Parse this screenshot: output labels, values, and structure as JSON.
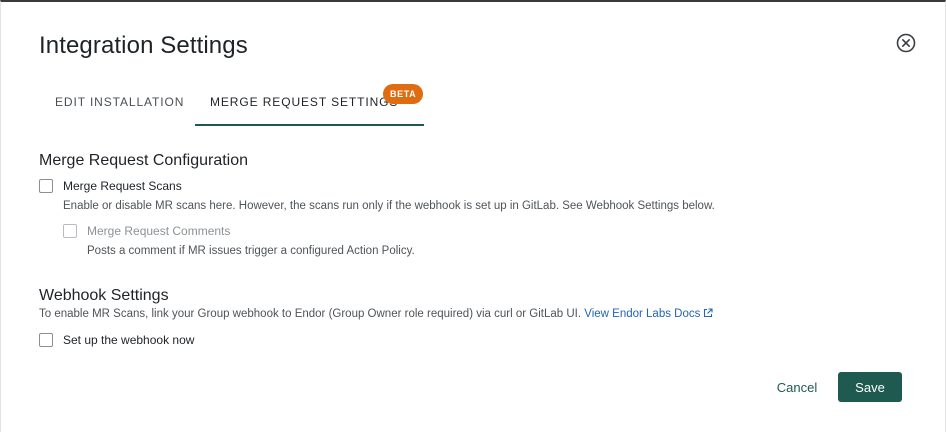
{
  "dialog": {
    "title": "Integration Settings",
    "close_icon": "close-circle-icon"
  },
  "tabs": [
    {
      "label": "EDIT INSTALLATION",
      "active": false
    },
    {
      "label": "MERGE REQUEST SETTINGS",
      "active": true,
      "badge": "BETA"
    }
  ],
  "mr_config": {
    "heading": "Merge Request Configuration",
    "scans_label": "Merge Request Scans",
    "scans_checked": false,
    "scans_description": "Enable or disable MR scans here. However, the scans run only if the webhook is set up in GitLab. See Webhook Settings below.",
    "comments_label": "Merge Request Comments",
    "comments_checked": false,
    "comments_disabled": true,
    "comments_description": "Posts a comment if MR issues trigger a configured Action Policy."
  },
  "webhook": {
    "heading": "Webhook Settings",
    "description": "To enable MR Scans, link your Group webhook to Endor (Group Owner role required) via curl or GitLab UI.",
    "docs_link": "View Endor Labs Docs",
    "docs_icon": "external-link-icon",
    "setup_label": "Set up the webhook now",
    "setup_checked": false
  },
  "footer": {
    "cancel_label": "Cancel",
    "save_label": "Save"
  },
  "colors": {
    "accent": "#1e5a4f",
    "badge": "#e06c12",
    "link": "#2264b8"
  }
}
